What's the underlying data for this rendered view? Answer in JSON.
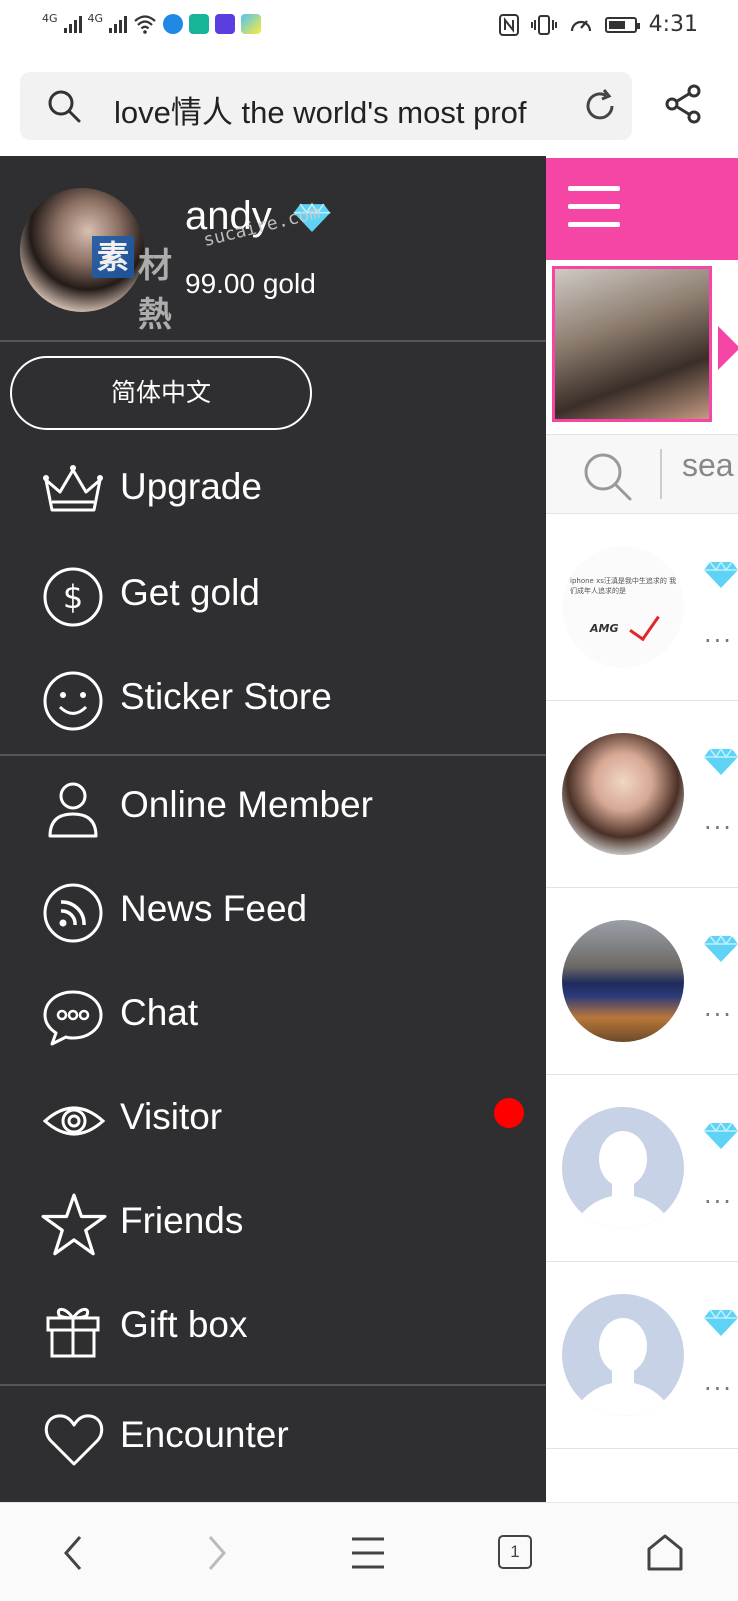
{
  "status_bar": {
    "network_1": "4G",
    "network_2": "4G",
    "time": "4:31"
  },
  "address_bar": {
    "url_text": "love情人 the world's most prof"
  },
  "user": {
    "name": "andy",
    "gold": "99.00 gold"
  },
  "watermark": {
    "glyph": "素",
    "text": "材熱",
    "url": "sucaire.com"
  },
  "language_button": "简体中文",
  "menu": {
    "items": [
      {
        "label": "Upgrade",
        "icon": "crown-icon"
      },
      {
        "label": "Get gold",
        "icon": "dollar-icon"
      },
      {
        "label": "Sticker Store",
        "icon": "smiley-icon"
      },
      {
        "label": "Online Member",
        "icon": "person-icon"
      },
      {
        "label": "News Feed",
        "icon": "rss-icon"
      },
      {
        "label": "Chat",
        "icon": "chat-bubble-icon"
      },
      {
        "label": "Visitor",
        "icon": "eye-icon",
        "badge": "red-dot"
      },
      {
        "label": "Friends",
        "icon": "star-icon"
      },
      {
        "label": "Gift box",
        "icon": "gift-icon"
      },
      {
        "label": "Encounter",
        "icon": "heart-icon"
      }
    ]
  },
  "background_page": {
    "search_placeholder": "sea",
    "list_dots": [
      "...",
      "...",
      "...",
      "...",
      "..."
    ],
    "amg_text": "iphone xs汪滇是我中生追求的 我们成年人追求的是",
    "amg_logo": "AMG"
  },
  "bottom_nav": {
    "tab_count": "1"
  },
  "colors": {
    "drawer_bg": "#2f2f31",
    "accent_pink": "#f545a5",
    "diamond": "#5fd3f5",
    "badge_red": "#ff0000"
  }
}
